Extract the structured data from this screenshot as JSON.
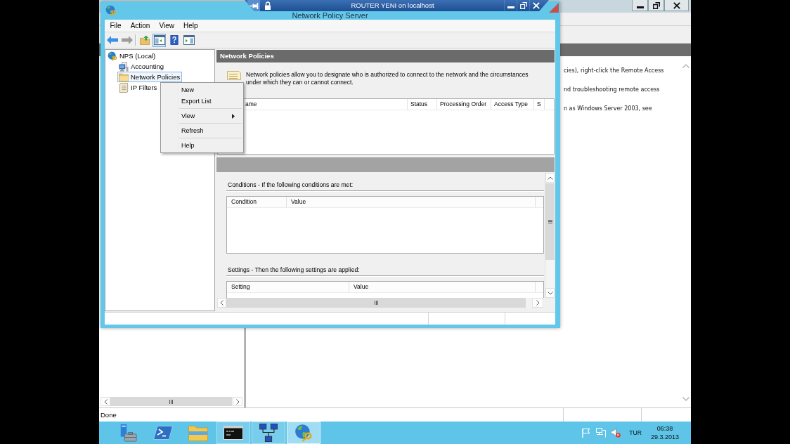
{
  "remote_bar": {
    "title": "ROUTER YENI on localhost",
    "pinned": true
  },
  "background_window": {
    "help_lines": [
      "cies), right-click the Remote Access",
      "nd troubleshooting remote access",
      "n as Windows Server 2003, see"
    ],
    "status": "Done"
  },
  "window": {
    "title": "Network Policy Server",
    "menu": [
      "File",
      "Action",
      "View",
      "Help"
    ],
    "toolbar": [
      {
        "disabled": false,
        "pressed": false
      },
      {
        "disabled": true,
        "pressed": false
      },
      {
        "disabled": false,
        "pressed": false
      },
      {
        "disabled": false,
        "pressed": true
      },
      {
        "disabled": false,
        "pressed": false
      },
      {
        "disabled": false,
        "pressed": false
      }
    ],
    "tree": [
      {
        "label": "NPS (Local)",
        "selected": false,
        "children": [
          {
            "label": "Accounting",
            "selected": false
          },
          {
            "label": "Network Policies",
            "selected": true
          },
          {
            "label": "IP Filters",
            "selected": false
          }
        ]
      }
    ],
    "context_menu": [
      {
        "kind": "item",
        "label": "New",
        "submenu": false
      },
      {
        "kind": "item",
        "label": "Export List",
        "submenu": false
      },
      {
        "kind": "separator"
      },
      {
        "kind": "item",
        "label": "View",
        "submenu": true
      },
      {
        "kind": "separator"
      },
      {
        "kind": "item",
        "label": "Refresh",
        "submenu": false
      },
      {
        "kind": "separator"
      },
      {
        "kind": "item",
        "label": "Help",
        "submenu": false
      }
    ],
    "pane": {
      "header": "Network Policies",
      "description": "Network policies allow you to designate who is authorized to connect to the network and the circumstances under which they can or cannot connect.",
      "policy_columns": [
        "ame",
        "Status",
        "Processing Order",
        "Access Type",
        "S"
      ],
      "conditions": {
        "heading": "Conditions - If the following conditions are met:",
        "columns": [
          "Condition",
          "Value"
        ]
      },
      "settings": {
        "heading": "Settings - Then the following settings are applied:",
        "columns": [
          "Setting",
          "Value"
        ]
      }
    }
  },
  "taskbar": {
    "apps": [
      {
        "running": false,
        "active": false
      },
      {
        "running": false,
        "active": false
      },
      {
        "running": false,
        "active": false
      },
      {
        "running": true,
        "active": false
      },
      {
        "running": true,
        "active": false
      },
      {
        "running": true,
        "active": true
      }
    ],
    "tray": {
      "muted": true,
      "language": "TUR",
      "time": "06:38",
      "date": "29.3.2013"
    }
  }
}
